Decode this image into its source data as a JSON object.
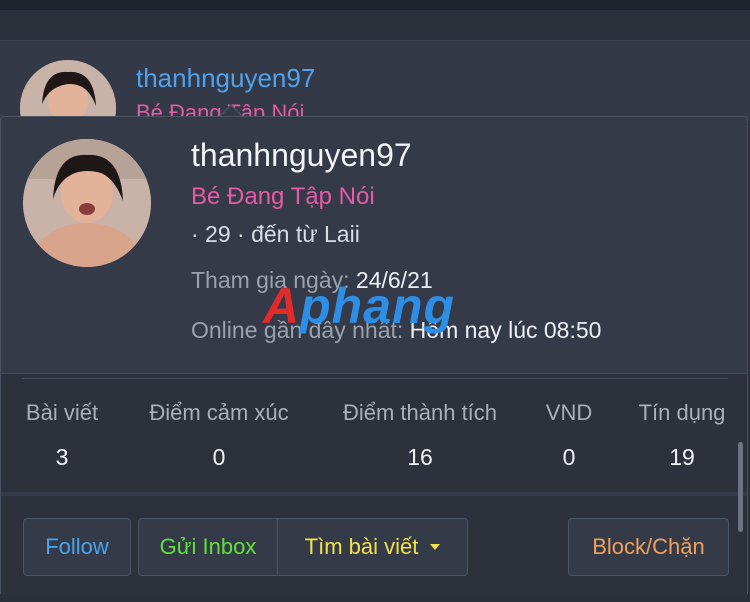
{
  "background_card": {
    "username": "thanhnguyen97",
    "title": "Bé Đang Tập Nói"
  },
  "profile": {
    "username": "thanhnguyen97",
    "title": "Bé Đang Tập Nói",
    "meta": "· 29 · đến từ Laii",
    "joined_label": "Tham gia ngày:",
    "joined_value": "24/6/21",
    "online_label": "Online gần đây nhất:",
    "online_value": "Hôm nay lúc 08:50"
  },
  "watermark": {
    "part1": "A",
    "part2": "phang"
  },
  "stats": [
    {
      "label": "Bài viết",
      "value": "3"
    },
    {
      "label": "Điểm cảm xúc",
      "value": "0"
    },
    {
      "label": "Điểm thành tích",
      "value": "16"
    },
    {
      "label": "VND",
      "value": "0"
    },
    {
      "label": "Tín dụng",
      "value": "19"
    }
  ],
  "actions": {
    "follow": "Follow",
    "inbox": "Gửi Inbox",
    "find_posts": "Tìm bài viết",
    "block": "Block/Chặn"
  },
  "colors": {
    "username_link": "#4fa3ee",
    "title_pink": "#e65aa8",
    "follow": "#4aa3f0",
    "inbox": "#5fe03a",
    "find_posts": "#f2e14a",
    "block": "#f0a05a"
  }
}
